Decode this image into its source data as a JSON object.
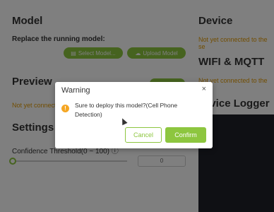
{
  "model": {
    "title": "Model",
    "replace_label": "Replace the running model:",
    "select_button": "Select Model...",
    "upload_button": "Upload Model"
  },
  "preview": {
    "title": "Preview",
    "status": "Not yet connect"
  },
  "settings": {
    "title": "Settings",
    "confidence_label": "Confidence Threshold(0 ~ 100)",
    "confidence_value": "0"
  },
  "device": {
    "title": "Device",
    "status": "Not yet connected to the se"
  },
  "wifi": {
    "title": "WIFI & MQTT",
    "status": "Not yet connected to the se"
  },
  "logger": {
    "title": "evice Logger"
  },
  "dialog": {
    "title": "Warning",
    "close_glyph": "×",
    "icon_glyph": "!",
    "message": "Sure to deploy this model?(Cell Phone Detection)",
    "cancel_label": "Cancel",
    "confirm_label": "Confirm"
  },
  "colors": {
    "accent": "#8dc63f",
    "warning": "#e39a00",
    "logger_bg": "#1f2029"
  }
}
